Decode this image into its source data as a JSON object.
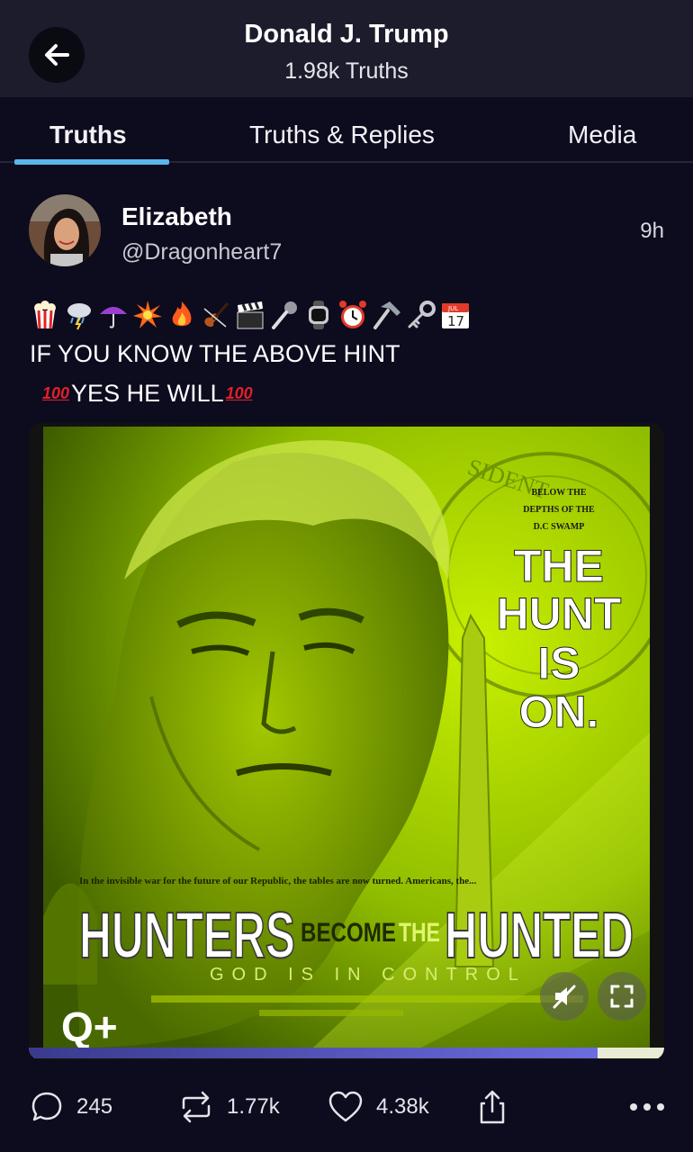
{
  "header": {
    "title": "Donald J. Trump",
    "subtitle": "1.98k Truths"
  },
  "tabs": [
    {
      "label": "Truths",
      "active": true
    },
    {
      "label": "Truths & Replies",
      "active": false
    },
    {
      "label": "Media",
      "active": false
    }
  ],
  "post": {
    "author_name": "Elizabeth",
    "author_handle": "@Dragonheart7",
    "time": "9h",
    "emoji_icons": [
      "popcorn",
      "storm-cloud",
      "umbrella",
      "explosion",
      "fire",
      "violin",
      "clapperboard",
      "microphone",
      "watch",
      "alarm-clock",
      "hammer",
      "key",
      "calendar"
    ],
    "calendar_label": "JUL",
    "calendar_day": "17",
    "text_line1": "IF YOU KNOW THE ABOVE HINT",
    "text_line2": "YES HE WILL",
    "hundred_emoji": "100"
  },
  "media": {
    "poster_small": [
      "BELOW THE",
      "DEPTHS OF THE",
      "D.C SWAMP"
    ],
    "poster_big": [
      "THE",
      "HUNT",
      "IS",
      "ON."
    ],
    "seal_text": "SIDENT",
    "caption": "In the invisible war for the future of our Republic, the tables are now turned. Americans, the...",
    "hunters": "HUNTERS",
    "become": "BECOME",
    "the": "THE",
    "hunted": "HUNTED",
    "god": "GOD IS IN CONTROL",
    "q_plus": "Q+",
    "progress": 0.895
  },
  "actions": {
    "replies": "245",
    "retruths": "1.77k",
    "likes": "4.38k"
  },
  "colors": {
    "background": "#0d0b1e",
    "header": "#1c1c2c",
    "tab_underline": "#5bb7ea",
    "poster_green": "#b8e600"
  }
}
